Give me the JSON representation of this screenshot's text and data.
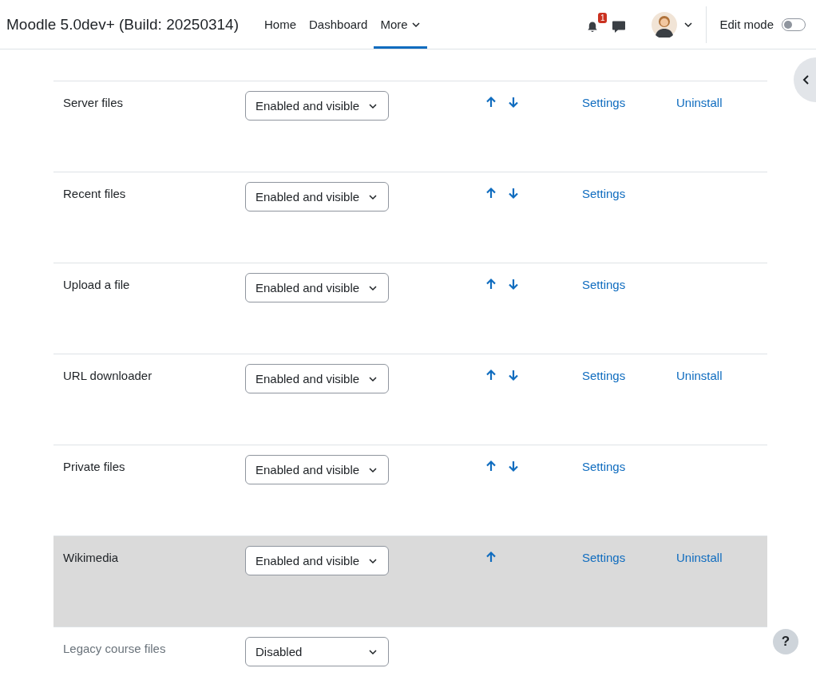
{
  "navbar": {
    "site_name": "Moodle 5.0dev+ (Build: 20250314)",
    "nav_items": [
      {
        "label": "Home",
        "selected": false,
        "kind": "link"
      },
      {
        "label": "Dashboard",
        "selected": false,
        "kind": "link"
      },
      {
        "label": "More",
        "selected": true,
        "kind": "dropdown"
      }
    ],
    "notification_count": "1",
    "edit_mode": {
      "label": "Edit mode",
      "on": false
    }
  },
  "repositories": [
    {
      "name": "Server files",
      "state": "Enabled and visible",
      "move_up": true,
      "move_down": true,
      "settings": "Settings",
      "uninstall": "Uninstall",
      "highlighted": false,
      "disabled": false
    },
    {
      "name": "Recent files",
      "state": "Enabled and visible",
      "move_up": true,
      "move_down": true,
      "settings": "Settings",
      "highlighted": false,
      "disabled": false
    },
    {
      "name": "Upload a file",
      "state": "Enabled and visible",
      "move_up": true,
      "move_down": true,
      "settings": "Settings",
      "highlighted": false,
      "disabled": false
    },
    {
      "name": "URL downloader",
      "state": "Enabled and visible",
      "move_up": true,
      "move_down": true,
      "settings": "Settings",
      "uninstall": "Uninstall",
      "highlighted": false,
      "disabled": false
    },
    {
      "name": "Private files",
      "state": "Enabled and visible",
      "move_up": true,
      "move_down": true,
      "settings": "Settings",
      "highlighted": false,
      "disabled": false
    },
    {
      "name": "Wikimedia",
      "state": "Enabled and visible",
      "move_up": true,
      "move_down": false,
      "settings": "Settings",
      "uninstall": "Uninstall",
      "highlighted": true,
      "disabled": false
    },
    {
      "name": "Legacy course files",
      "state": "Disabled",
      "move_up": false,
      "move_down": false,
      "highlighted": false,
      "disabled": true
    }
  ],
  "help_button": "?"
}
